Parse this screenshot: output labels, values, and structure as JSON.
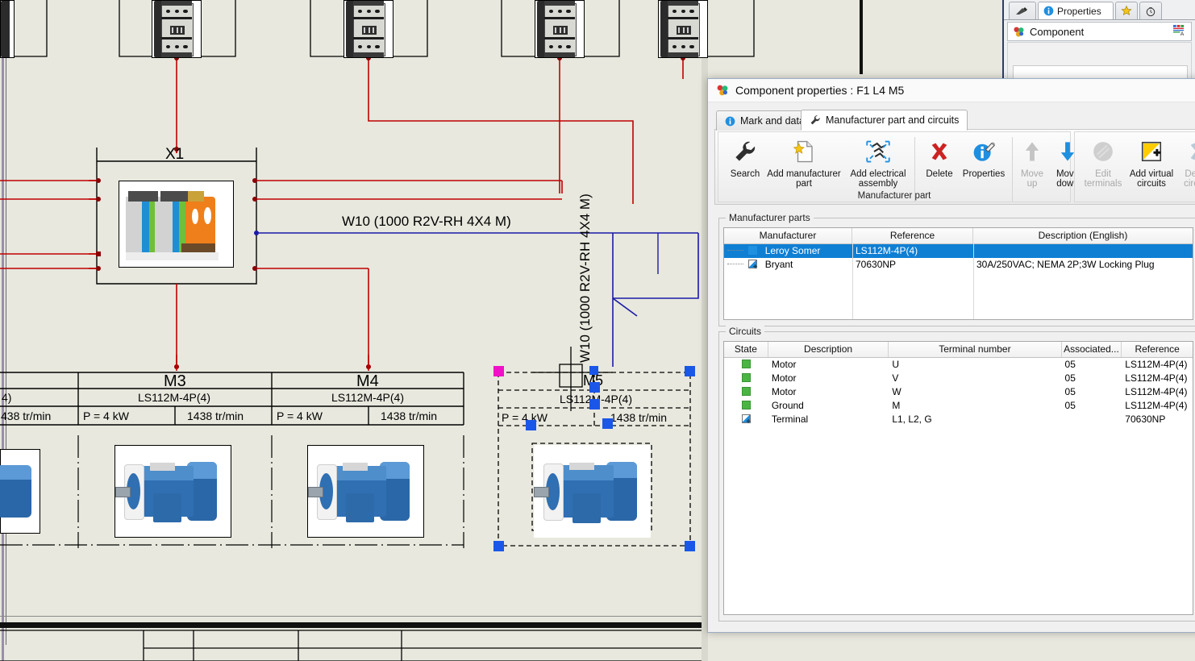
{
  "drawing": {
    "terminal_block_label": "X1",
    "cable_label_h": "W10 (1000 R2V-RH 4X4 M)",
    "cable_label_v": "W10 (1000 R2V-RH 4X4 M)",
    "motor_table": {
      "columns": [
        "M3",
        "M4"
      ],
      "partial_left_ref": "4)",
      "partial_left_speed": "438 tr/min",
      "rows": [
        {
          "tag": "M3",
          "reference": "LS112M-4P(4)",
          "power": "P =   4 kW",
          "speed": "1438 tr/min"
        },
        {
          "tag": "M4",
          "reference": "LS112M-4P(4)",
          "power": "P =   4 kW",
          "speed": "1438 tr/min"
        }
      ]
    },
    "selected_item": {
      "tag": "M5",
      "reference": "LS112M-4P(4)",
      "power": "P =   4 kW",
      "speed": "1438 tr/min"
    },
    "colors": {
      "background": "#e8e8de",
      "wire_red": "#c00000",
      "wire_blue": "#1a1aa8",
      "selection_handle": "#1a56e8",
      "selection_origin": "#f010c8"
    }
  },
  "dock": {
    "tabs": [
      {
        "name": "tab-pen",
        "label": ""
      },
      {
        "name": "tab-properties",
        "label": "Properties"
      },
      {
        "name": "tab-favorites",
        "label": ""
      },
      {
        "name": "tab-history",
        "label": ""
      }
    ],
    "properties_label": "Properties",
    "sub_label": "Component",
    "icon_right": "text-attributes-icon"
  },
  "dialog": {
    "title": "Component properties : F1 L4 M5",
    "icon": "component-icon",
    "tabs": [
      {
        "label": "Mark and data",
        "icon": "info-icon",
        "active": false
      },
      {
        "label": "Manufacturer part and circuits",
        "icon": "wrench-icon",
        "active": true
      }
    ],
    "ribbon": {
      "groups": [
        {
          "label": "Manufacturer part",
          "buttons": [
            {
              "label": "Search",
              "icon": "wrench-icon",
              "enabled": true
            },
            {
              "label": "Add manufacturer part",
              "icon": "new-page-star-icon",
              "enabled": true
            },
            {
              "label": "Add electrical assembly",
              "icon": "assembly-icon",
              "enabled": true
            },
            {
              "label": "Delete",
              "icon": "red-x-icon",
              "enabled": true
            },
            {
              "label": "Properties",
              "icon": "info-pencil-icon",
              "enabled": true
            },
            {
              "label": "Move up",
              "icon": "arrow-up-icon",
              "enabled": false
            },
            {
              "label": "Move down",
              "icon": "arrow-down-icon",
              "enabled": true
            }
          ]
        },
        {
          "label": "",
          "buttons": [
            {
              "label": "Edit terminals",
              "icon": "terminal-disc-icon",
              "enabled": false
            },
            {
              "label": "Add virtual circuits",
              "icon": "yellow-plus-icon",
              "enabled": true
            },
            {
              "label": "Delete circuits",
              "icon": "blue-x-icon",
              "enabled": false
            }
          ]
        }
      ]
    },
    "manufacturer_parts": {
      "caption": "Manufacturer parts",
      "columns": [
        "Manufacturer",
        "Reference",
        "Description (English)"
      ],
      "rows": [
        {
          "state": "blue",
          "manufacturer": "Leroy Somer",
          "reference": "LS112M-4P(4)",
          "description": "",
          "selected": true
        },
        {
          "state": "tri",
          "manufacturer": "Bryant",
          "reference": "70630NP",
          "description": "30A/250VAC; NEMA 2P;3W Locking Plug",
          "selected": false
        }
      ]
    },
    "circuits": {
      "caption": "Circuits",
      "columns": [
        "State",
        "Description",
        "Terminal number",
        "Associated...",
        "Reference"
      ],
      "rows": [
        {
          "state": "green",
          "description": "Motor",
          "terminal": "U",
          "associated": "05",
          "reference": "LS112M-4P(4)"
        },
        {
          "state": "green",
          "description": "Motor",
          "terminal": "V",
          "associated": "05",
          "reference": "LS112M-4P(4)"
        },
        {
          "state": "green",
          "description": "Motor",
          "terminal": "W",
          "associated": "05",
          "reference": "LS112M-4P(4)"
        },
        {
          "state": "green",
          "description": "Ground",
          "terminal": "M",
          "associated": "05",
          "reference": "LS112M-4P(4)"
        },
        {
          "state": "tri",
          "description": "Terminal",
          "terminal": "L1, L2, G",
          "associated": "",
          "reference": "70630NP"
        }
      ]
    },
    "colors": {
      "selection_blue": "#0f7fd4",
      "accent_blue": "#1f8fe0",
      "state_green": "#4bb543",
      "delete_red": "#cc2222",
      "virtual_yellow": "#ffcc00"
    }
  }
}
